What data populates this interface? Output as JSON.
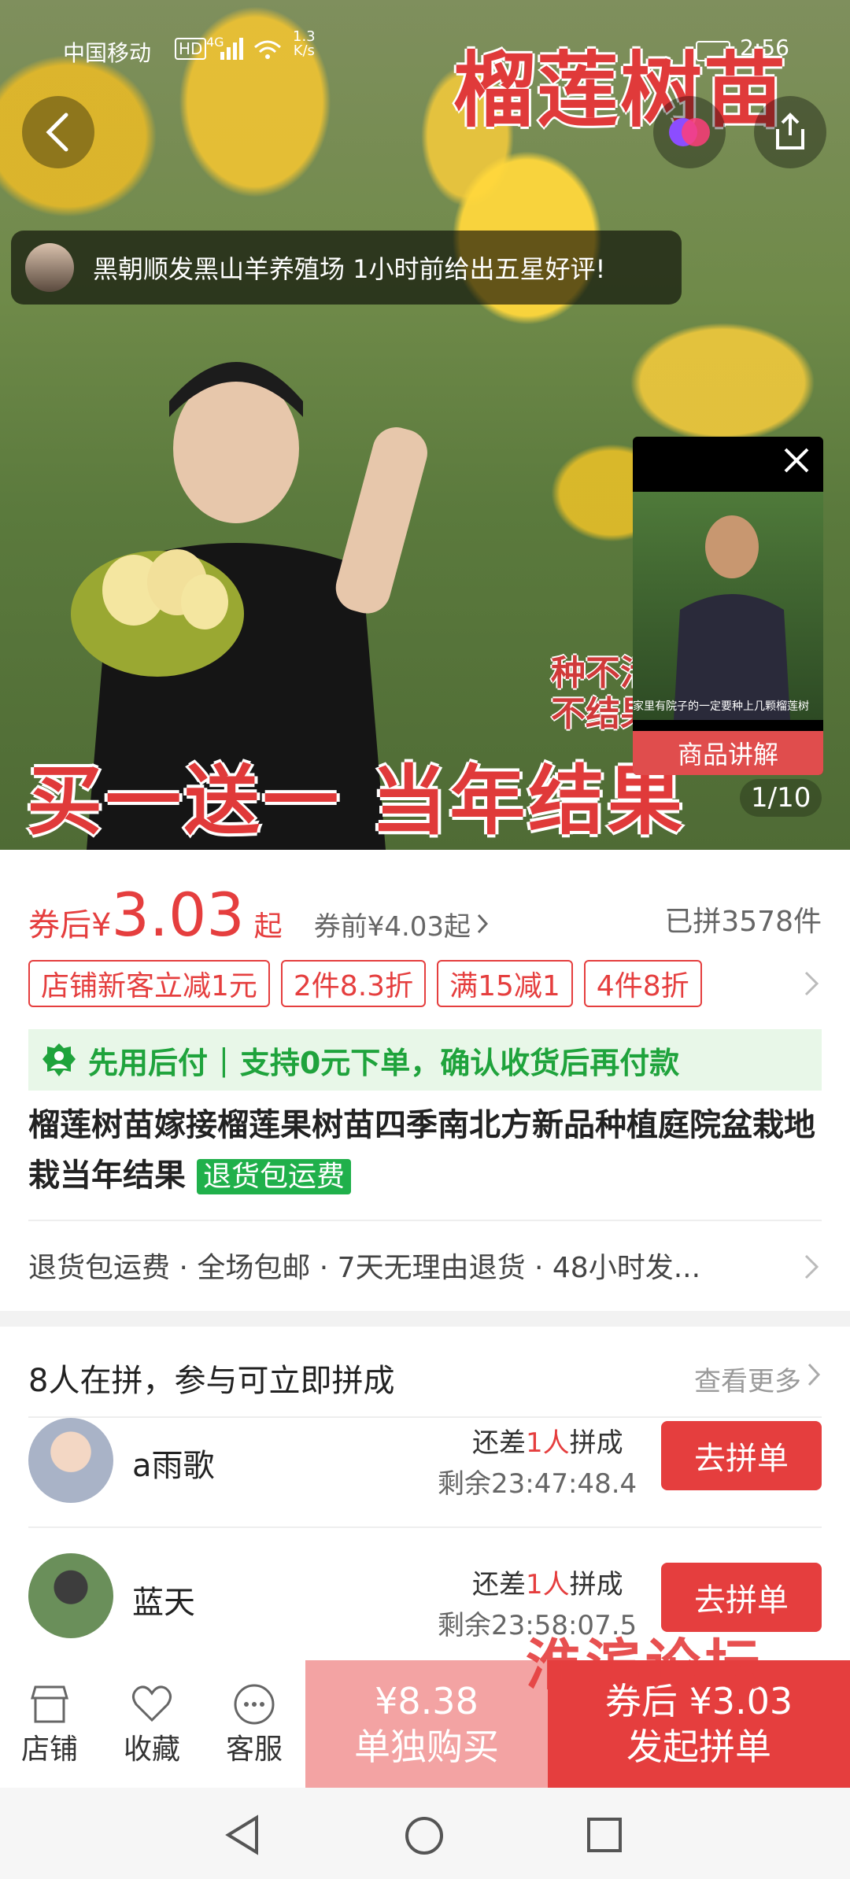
{
  "status_bar": {
    "carrier": "中国移动",
    "hd": "HD",
    "net": "4G",
    "speed_top": "1.3",
    "speed_unit": "K/s",
    "time": "2:56"
  },
  "hero": {
    "title": "榴莲树苗",
    "review": "黑朝顺发黑山羊养殖场 1小时前给出五星好评!",
    "side_text_1": "种不活",
    "side_text_2": "不结果",
    "bottom_slogan": "买一送一 当年结果",
    "pager": "1/10",
    "video_caption": "家里有院子的一定要种上几颗榴莲树",
    "video_label": "商品讲解"
  },
  "price": {
    "after_label": "券后",
    "currency": "¥",
    "value": "3.03",
    "suffix": "起",
    "before": "券前¥4.03起",
    "sold": "已拼3578件"
  },
  "tags": [
    "店铺新客立减1元",
    "2件8.3折",
    "满15减1",
    "4件8折"
  ],
  "pay_later": {
    "a": "先用后付",
    "b": "支持0元下单，确认收货后再付款"
  },
  "product": {
    "title": "榴莲树苗嫁接榴莲果树苗四季南北方新品种植庭院盆栽地栽当年结果",
    "badge": "退货包运费"
  },
  "services": "退货包运费 · 全场包邮 · 7天无理由退货 · 48小时发...",
  "group": {
    "heading": "8人在拼，参与可立即拼成",
    "more": "查看更多",
    "users": [
      {
        "name": "a雨歌",
        "need_prefix": "还差",
        "need_count": "1人",
        "need_suffix": "拼成",
        "timer": "剩余23:47:48.4",
        "button": "去拼单"
      },
      {
        "name": "蓝天",
        "need_prefix": "还差",
        "need_count": "1人",
        "need_suffix": "拼成",
        "timer": "剩余23:58:07.5",
        "button": "去拼单"
      }
    ]
  },
  "bottom": {
    "shop": "店铺",
    "fav": "收藏",
    "service": "客服",
    "single_price": "¥8.38",
    "single_label": "单独购买",
    "group_price": "券后 ¥3.03",
    "group_label": "发起拼单",
    "watermark": "淮滨论坛"
  }
}
